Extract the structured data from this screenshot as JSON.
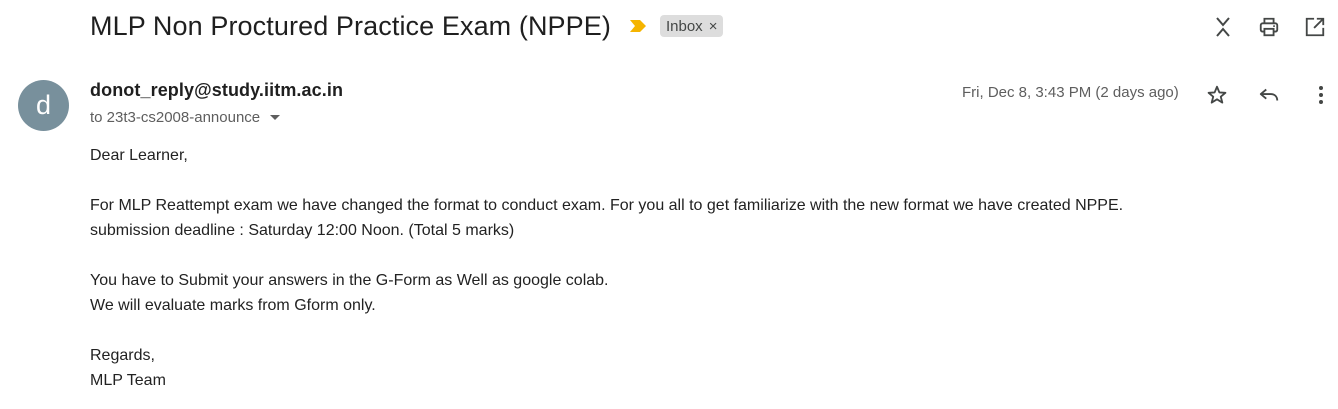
{
  "email": {
    "subject": "MLP Non Proctured Practice Exam (NPPE)",
    "label": "Inbox",
    "label_close": "×",
    "sender_initial": "d",
    "sender": "donot_reply@study.iitm.ac.in",
    "recipient": "to 23t3-cs2008-announce",
    "timestamp": "Fri, Dec 8, 3:43 PM (2 days ago)",
    "body": {
      "greeting": "Dear Learner,",
      "p1_line1": "For MLP Reattempt exam we have changed the format to conduct exam. For you all to get familiarize with the new format we have created NPPE.",
      "p1_line2": "submission deadline : Saturday 12:00 Noon. (Total 5 marks)",
      "p2_line1": "You have to Submit your answers in the G-Form as Well as google colab.",
      "p2_line2": "We will evaluate marks from Gform only.",
      "closing": "Regards,",
      "signature": "MLP Team"
    }
  },
  "icons": {
    "importance": "importance-marker-icon",
    "collapse": "collapse-all-icon",
    "print": "print-icon",
    "open_new_window": "open-in-new-window-icon",
    "star": "star-icon",
    "reply": "reply-icon",
    "more": "more-vert-icon",
    "dropdown": "chevron-down-icon"
  },
  "colors": {
    "importance": "#f5b400",
    "avatar": "#78909c",
    "chip_bg": "#dddddd"
  }
}
